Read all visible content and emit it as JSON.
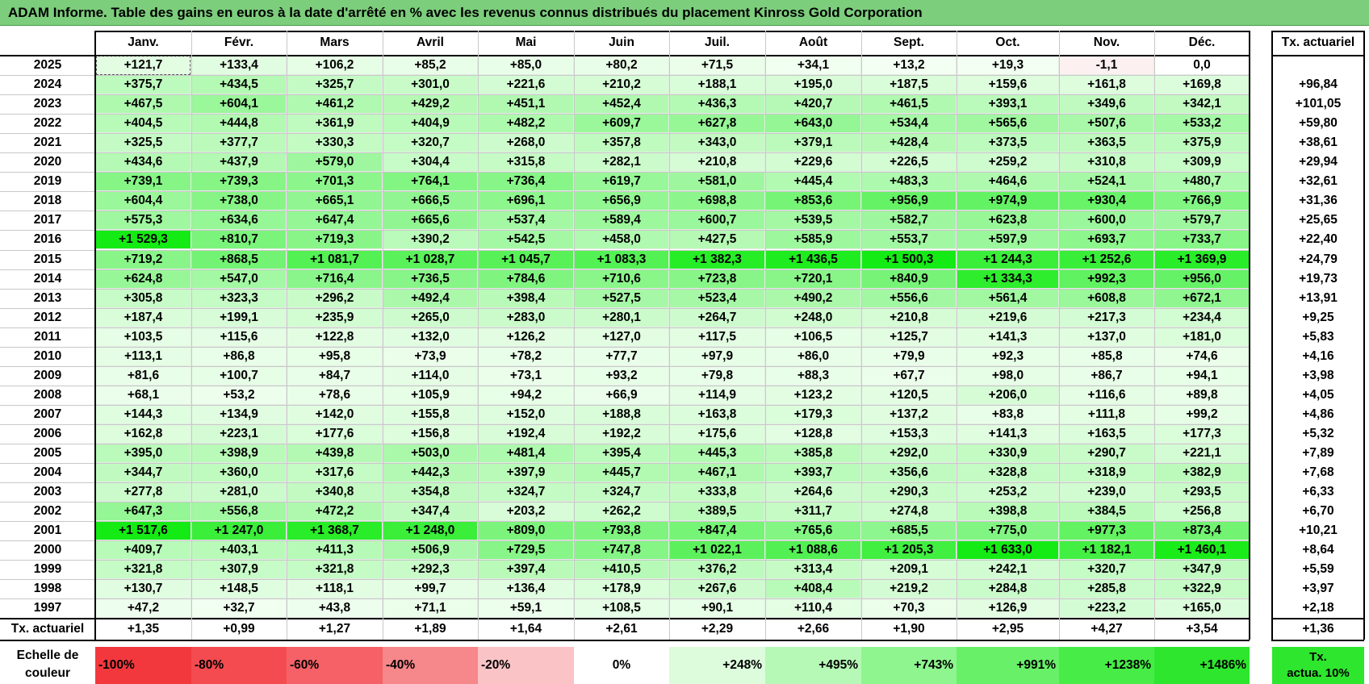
{
  "title": "ADAM Informe. Table des gains en euros à la date d'arrêté en % avec les revenus connus distribués du placement Kinross Gold Corporation",
  "months": [
    "Janv.",
    "Févr.",
    "Mars",
    "Avril",
    "Mai",
    "Juin",
    "Juil.",
    "Août",
    "Sept.",
    "Oct.",
    "Nov.",
    "Déc."
  ],
  "annual_header": "Tx. actuariel",
  "rows": [
    {
      "year": "2025",
      "values": [
        "+121,7",
        "+133,4",
        "+106,2",
        "+85,2",
        "+85,0",
        "+80,2",
        "+71,5",
        "+34,1",
        "+13,2",
        "+19,3",
        "-1,1",
        "0,0"
      ],
      "rate": ""
    },
    {
      "year": "2024",
      "values": [
        "+375,7",
        "+434,5",
        "+325,7",
        "+301,0",
        "+221,6",
        "+210,2",
        "+188,1",
        "+195,0",
        "+187,5",
        "+159,6",
        "+161,8",
        "+169,8"
      ],
      "rate": "+96,84"
    },
    {
      "year": "2023",
      "values": [
        "+467,5",
        "+604,1",
        "+461,2",
        "+429,2",
        "+451,1",
        "+452,4",
        "+436,3",
        "+420,7",
        "+461,5",
        "+393,1",
        "+349,6",
        "+342,1"
      ],
      "rate": "+101,05"
    },
    {
      "year": "2022",
      "values": [
        "+404,5",
        "+444,8",
        "+361,9",
        "+404,9",
        "+482,2",
        "+609,7",
        "+627,8",
        "+643,0",
        "+534,4",
        "+565,6",
        "+507,6",
        "+533,2"
      ],
      "rate": "+59,80"
    },
    {
      "year": "2021",
      "values": [
        "+325,5",
        "+377,7",
        "+330,3",
        "+320,7",
        "+268,0",
        "+357,8",
        "+343,0",
        "+379,1",
        "+428,4",
        "+373,5",
        "+363,5",
        "+375,9"
      ],
      "rate": "+38,61"
    },
    {
      "year": "2020",
      "values": [
        "+434,6",
        "+437,9",
        "+579,0",
        "+304,4",
        "+315,8",
        "+282,1",
        "+210,8",
        "+229,6",
        "+226,5",
        "+259,2",
        "+310,8",
        "+309,9"
      ],
      "rate": "+29,94"
    },
    {
      "year": "2019",
      "values": [
        "+739,1",
        "+739,3",
        "+701,3",
        "+764,1",
        "+736,4",
        "+619,7",
        "+581,0",
        "+445,4",
        "+483,3",
        "+464,6",
        "+524,1",
        "+480,7"
      ],
      "rate": "+32,61"
    },
    {
      "year": "2018",
      "values": [
        "+604,4",
        "+738,0",
        "+665,1",
        "+666,5",
        "+696,1",
        "+656,9",
        "+698,8",
        "+853,6",
        "+956,9",
        "+974,9",
        "+930,4",
        "+766,9"
      ],
      "rate": "+31,36"
    },
    {
      "year": "2017",
      "values": [
        "+575,3",
        "+634,6",
        "+647,4",
        "+665,6",
        "+537,4",
        "+589,4",
        "+600,7",
        "+539,5",
        "+582,7",
        "+623,8",
        "+600,0",
        "+579,7"
      ],
      "rate": "+25,65"
    },
    {
      "year": "2016",
      "values": [
        "+1 529,3",
        "+810,7",
        "+719,3",
        "+390,2",
        "+542,5",
        "+458,0",
        "+427,5",
        "+585,9",
        "+553,7",
        "+597,9",
        "+693,7",
        "+733,7"
      ],
      "rate": "+22,40"
    },
    {
      "year": "2015",
      "values": [
        "+719,2",
        "+868,5",
        "+1 081,7",
        "+1 028,7",
        "+1 045,7",
        "+1 083,3",
        "+1 382,3",
        "+1 436,5",
        "+1 500,3",
        "+1 244,3",
        "+1 252,6",
        "+1 369,9"
      ],
      "rate": "+24,79"
    },
    {
      "year": "2014",
      "values": [
        "+624,8",
        "+547,0",
        "+716,4",
        "+736,5",
        "+784,6",
        "+710,6",
        "+723,8",
        "+720,1",
        "+840,9",
        "+1 334,3",
        "+992,3",
        "+956,0"
      ],
      "rate": "+19,73"
    },
    {
      "year": "2013",
      "values": [
        "+305,8",
        "+323,3",
        "+296,2",
        "+492,4",
        "+398,4",
        "+527,5",
        "+523,4",
        "+490,2",
        "+556,6",
        "+561,4",
        "+608,8",
        "+672,1"
      ],
      "rate": "+13,91"
    },
    {
      "year": "2012",
      "values": [
        "+187,4",
        "+199,1",
        "+235,9",
        "+265,0",
        "+283,0",
        "+280,1",
        "+264,7",
        "+248,0",
        "+210,8",
        "+219,6",
        "+217,3",
        "+234,4"
      ],
      "rate": "+9,25"
    },
    {
      "year": "2011",
      "values": [
        "+103,5",
        "+115,6",
        "+122,8",
        "+132,0",
        "+126,2",
        "+127,0",
        "+117,5",
        "+106,5",
        "+125,7",
        "+141,3",
        "+137,0",
        "+181,0"
      ],
      "rate": "+5,83"
    },
    {
      "year": "2010",
      "values": [
        "+113,1",
        "+86,8",
        "+95,8",
        "+73,9",
        "+78,2",
        "+77,7",
        "+97,9",
        "+86,0",
        "+79,9",
        "+92,3",
        "+85,8",
        "+74,6"
      ],
      "rate": "+4,16"
    },
    {
      "year": "2009",
      "values": [
        "+81,6",
        "+100,7",
        "+84,7",
        "+114,0",
        "+73,1",
        "+93,2",
        "+79,8",
        "+88,3",
        "+67,7",
        "+98,0",
        "+86,7",
        "+94,1"
      ],
      "rate": "+3,98"
    },
    {
      "year": "2008",
      "values": [
        "+68,1",
        "+53,2",
        "+78,6",
        "+105,9",
        "+94,2",
        "+66,9",
        "+114,9",
        "+123,2",
        "+120,5",
        "+206,0",
        "+116,6",
        "+89,8"
      ],
      "rate": "+4,05"
    },
    {
      "year": "2007",
      "values": [
        "+144,3",
        "+134,9",
        "+142,0",
        "+155,8",
        "+152,0",
        "+188,8",
        "+163,8",
        "+179,3",
        "+137,2",
        "+83,8",
        "+111,8",
        "+99,2"
      ],
      "rate": "+4,86"
    },
    {
      "year": "2006",
      "values": [
        "+162,8",
        "+223,1",
        "+177,6",
        "+156,8",
        "+192,4",
        "+192,2",
        "+175,6",
        "+128,8",
        "+153,3",
        "+141,3",
        "+163,5",
        "+177,3"
      ],
      "rate": "+5,32"
    },
    {
      "year": "2005",
      "values": [
        "+395,0",
        "+398,9",
        "+439,8",
        "+503,0",
        "+481,4",
        "+395,4",
        "+445,3",
        "+385,8",
        "+292,0",
        "+330,9",
        "+290,7",
        "+221,1"
      ],
      "rate": "+7,89"
    },
    {
      "year": "2004",
      "values": [
        "+344,7",
        "+360,0",
        "+317,6",
        "+442,3",
        "+397,9",
        "+445,7",
        "+467,1",
        "+393,7",
        "+356,6",
        "+328,8",
        "+318,9",
        "+382,9"
      ],
      "rate": "+7,68"
    },
    {
      "year": "2003",
      "values": [
        "+277,8",
        "+281,0",
        "+340,8",
        "+354,8",
        "+324,7",
        "+324,7",
        "+333,8",
        "+264,6",
        "+290,3",
        "+253,2",
        "+239,0",
        "+293,5"
      ],
      "rate": "+6,33"
    },
    {
      "year": "2002",
      "values": [
        "+647,3",
        "+556,8",
        "+472,2",
        "+347,4",
        "+203,2",
        "+262,2",
        "+389,5",
        "+311,7",
        "+274,8",
        "+398,8",
        "+384,5",
        "+256,8"
      ],
      "rate": "+6,70"
    },
    {
      "year": "2001",
      "values": [
        "+1 517,6",
        "+1 247,0",
        "+1 368,7",
        "+1 248,0",
        "+809,0",
        "+793,8",
        "+847,4",
        "+765,6",
        "+685,5",
        "+775,0",
        "+977,3",
        "+873,4"
      ],
      "rate": "+10,21"
    },
    {
      "year": "2000",
      "values": [
        "+409,7",
        "+403,1",
        "+411,3",
        "+506,9",
        "+729,5",
        "+747,8",
        "+1 022,1",
        "+1 088,6",
        "+1 205,3",
        "+1 633,0",
        "+1 182,1",
        "+1 460,1"
      ],
      "rate": "+8,64"
    },
    {
      "year": "1999",
      "values": [
        "+321,8",
        "+307,9",
        "+321,8",
        "+292,3",
        "+397,4",
        "+410,5",
        "+376,2",
        "+313,4",
        "+209,1",
        "+242,1",
        "+320,7",
        "+347,9"
      ],
      "rate": "+5,59"
    },
    {
      "year": "1998",
      "values": [
        "+130,7",
        "+148,5",
        "+118,1",
        "+99,7",
        "+136,4",
        "+178,9",
        "+267,6",
        "+408,4",
        "+219,2",
        "+284,8",
        "+285,8",
        "+322,9"
      ],
      "rate": "+3,97"
    },
    {
      "year": "1997",
      "values": [
        "+47,2",
        "+32,7",
        "+43,8",
        "+71,1",
        "+59,1",
        "+108,5",
        "+90,1",
        "+110,4",
        "+70,3",
        "+126,9",
        "+223,2",
        "+165,0"
      ],
      "rate": "+2,18"
    }
  ],
  "footer": {
    "label": "Tx. actuariel",
    "values": [
      "+1,35",
      "+0,99",
      "+1,27",
      "+1,89",
      "+1,64",
      "+2,61",
      "+2,29",
      "+2,66",
      "+1,90",
      "+2,95",
      "+4,27",
      "+3,54"
    ],
    "rate": "+1,36"
  },
  "scale": {
    "label_line1": "Echelle de",
    "label_line2": "couleur",
    "items": [
      {
        "text": "-100%",
        "color": "#f2383d"
      },
      {
        "text": "-80%",
        "color": "#f34b50"
      },
      {
        "text": "-60%",
        "color": "#f56166"
      },
      {
        "text": "-40%",
        "color": "#f6878a"
      },
      {
        "text": "-20%",
        "color": "#fac3c5"
      },
      {
        "text": "0%",
        "color": "#ffffff"
      },
      {
        "text": "+248%",
        "color": "#dcfcdc"
      },
      {
        "text": "+495%",
        "color": "#b6f8b6"
      },
      {
        "text": "+743%",
        "color": "#8ff58f"
      },
      {
        "text": "+991%",
        "color": "#68f068"
      },
      {
        "text": "+1238%",
        "color": "#47ec47"
      },
      {
        "text": "+1486%",
        "color": "#2de62d"
      }
    ],
    "legend_line1": "Tx.",
    "legend_line2": "actua. 10%",
    "legend_color": "#2de62d"
  },
  "colors": {
    "title_bar": "#7ccd7c",
    "max_green_value": 1500
  }
}
